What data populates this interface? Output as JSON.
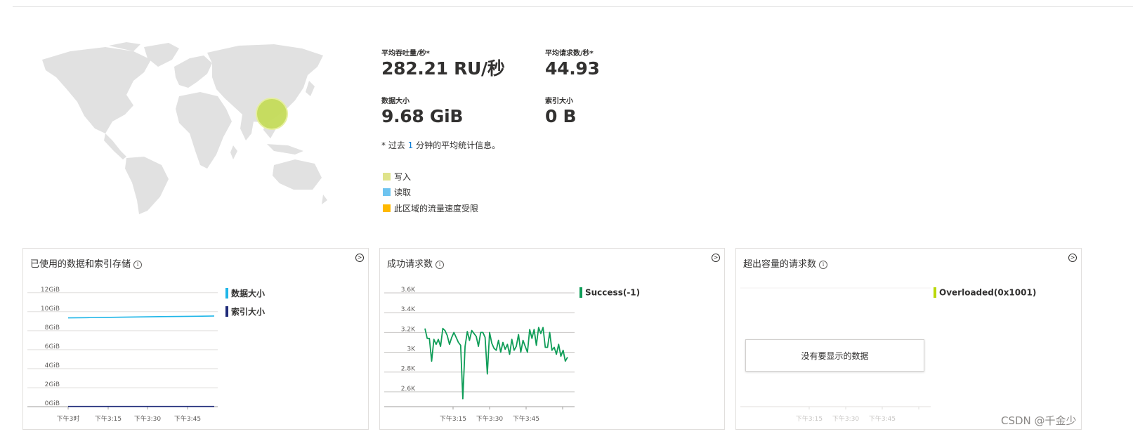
{
  "metrics": {
    "throughput_label": "平均吞吐量/秒*",
    "throughput_value": "282.21 RU/秒",
    "requests_label": "平均请求数/秒*",
    "requests_value": "44.93",
    "data_size_label": "数据大小",
    "data_size_value": "9.68 GiB",
    "index_size_label": "索引大小",
    "index_size_value": "0 B",
    "note_prefix": "* 过去 ",
    "note_number": "1",
    "note_suffix": " 分钟的平均统计信息。"
  },
  "legend": {
    "items": [
      {
        "label": "写入",
        "color": "#dfe38a"
      },
      {
        "label": "读取",
        "color": "#6ec4f0"
      },
      {
        "label": "此区域的流量速度受限",
        "color": "#ffb900"
      }
    ]
  },
  "cards": {
    "storage": {
      "title": "已使用的数据和索引存储",
      "legend": [
        {
          "label": "数据大小",
          "color": "#1fb6e8"
        },
        {
          "label": "索引大小",
          "color": "#1e2a78"
        }
      ]
    },
    "success": {
      "title": "成功请求数",
      "legend": [
        {
          "label": "Success(-1)",
          "color": "#0f9d58"
        }
      ]
    },
    "overloaded": {
      "title": "超出容量的请求数",
      "legend": [
        {
          "label": "Overloaded(0x1001)",
          "color": "#bad80a"
        }
      ],
      "no_data": "没有要显示的数据"
    }
  },
  "chart_data": [
    {
      "type": "line",
      "title": "已使用的数据和索引存储",
      "yticks": [
        "12GiB",
        "10GiB",
        "8GiB",
        "6GiB",
        "4GiB",
        "2GiB",
        "0GiB"
      ],
      "xticks": [
        "下午3时",
        "下午3:15",
        "下午3:30",
        "下午3:45"
      ],
      "ylim": [
        0,
        12.5
      ],
      "series": [
        {
          "name": "数据大小",
          "color": "#1fb6e8",
          "values": [
            9.35,
            9.37,
            9.4,
            9.42,
            9.45,
            9.48,
            9.5,
            9.52,
            9.55
          ]
        },
        {
          "name": "索引大小",
          "color": "#1e2a78",
          "values": [
            0.02,
            0.02,
            0.02,
            0.02,
            0.02,
            0.02,
            0.02,
            0.02,
            0.02
          ]
        }
      ]
    },
    {
      "type": "line",
      "title": "成功请求数",
      "yticks": [
        "3.6K",
        "3.4K",
        "3.2K",
        "3K",
        "2.8K",
        "2.6K"
      ],
      "xticks": [
        "下午3:15",
        "下午3:30",
        "下午3:45"
      ],
      "ylim": [
        2450,
        3650
      ],
      "series": [
        {
          "name": "Success(-1)",
          "color": "#0f9d58",
          "values": [
            3240,
            3140,
            3140,
            2910,
            3130,
            3080,
            3130,
            3060,
            3240,
            3220,
            3170,
            3080,
            3150,
            3200,
            3150,
            3100,
            3070,
            2530,
            3060,
            3210,
            3120,
            3220,
            3190,
            3160,
            3060,
            3200,
            3200,
            3150,
            2780,
            3200,
            3090,
            3040,
            3020,
            3120,
            3000,
            3100,
            3030,
            3080,
            2980,
            3130,
            3020,
            3060,
            3180,
            3000,
            3120,
            3060,
            3000,
            3230,
            3140,
            3230,
            3070,
            3250,
            3190,
            3250,
            3050,
            3050,
            3200,
            3020,
            3050,
            2980,
            3080,
            2960,
            3020,
            2910,
            2950
          ]
        }
      ]
    },
    {
      "type": "line",
      "title": "超出容量的请求数",
      "xticks": [
        "下午3:15",
        "下午3:30",
        "下午3:45"
      ],
      "series": [
        {
          "name": "Overloaded(0x1001)",
          "values": []
        }
      ]
    }
  ],
  "watermark": "CSDN @千金少"
}
